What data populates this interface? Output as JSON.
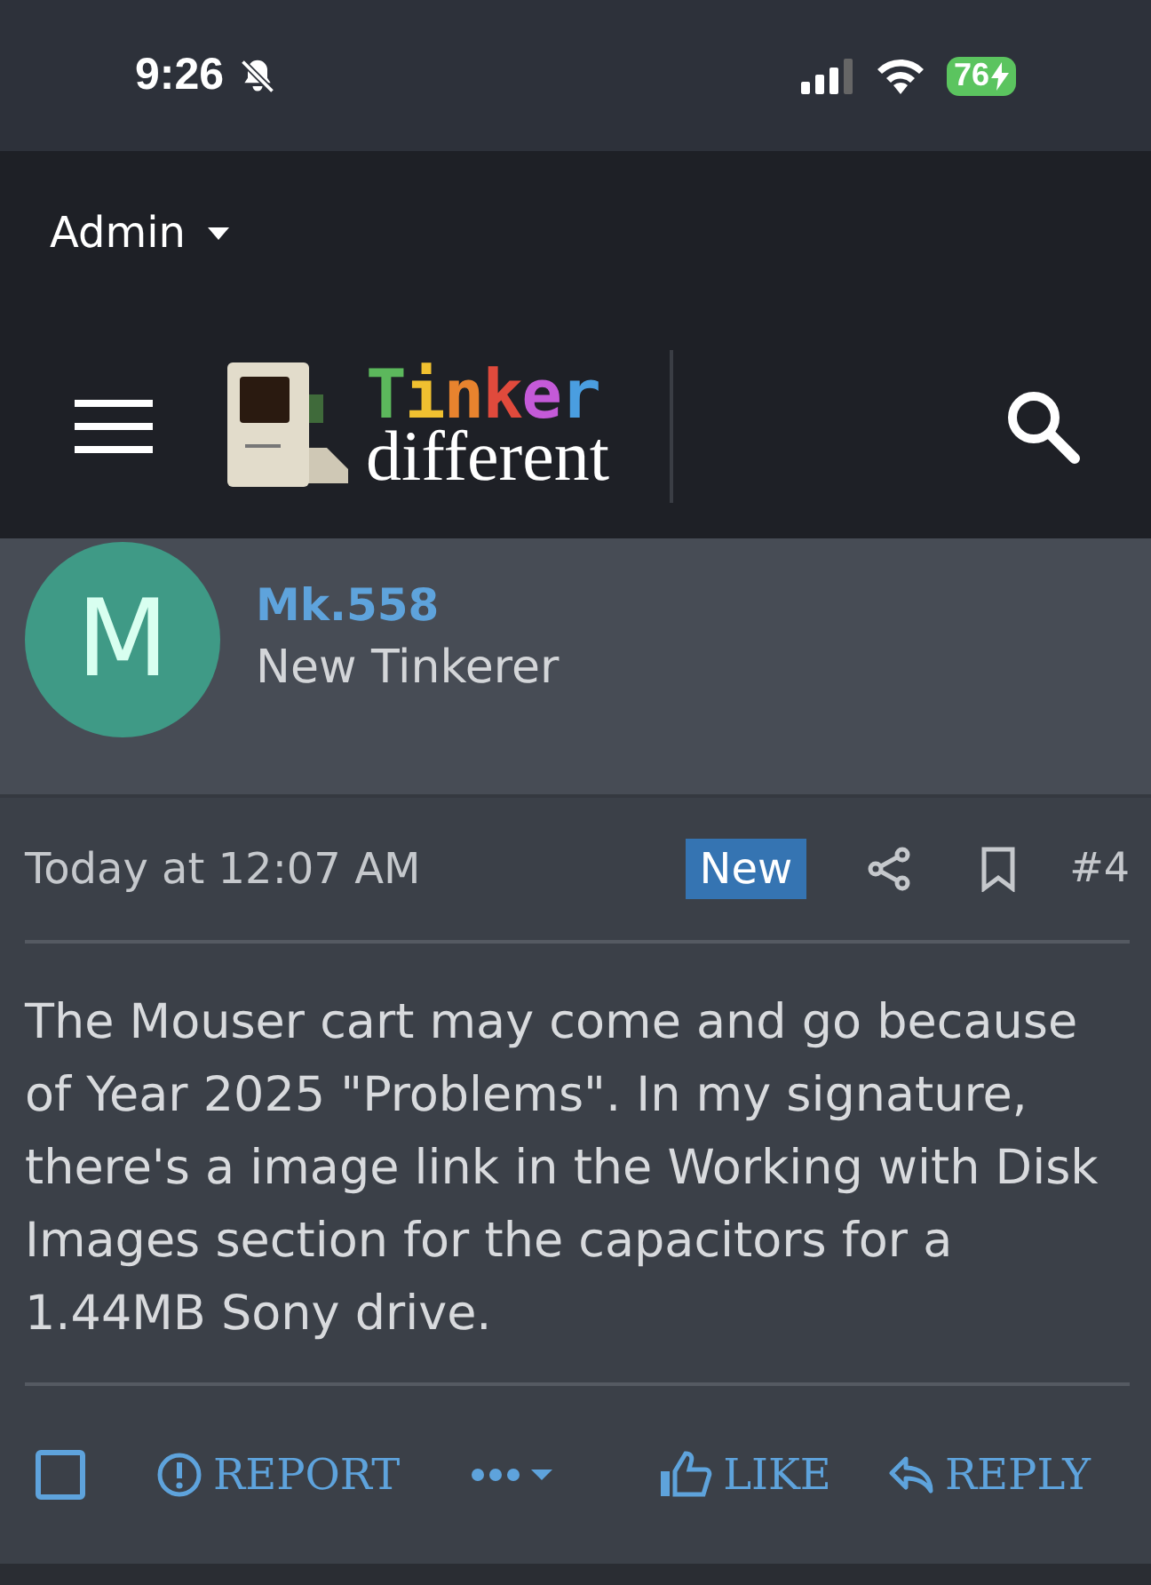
{
  "status_bar": {
    "time": "9:26",
    "battery": "76",
    "charging": true
  },
  "account_menu": {
    "label": "Admin"
  },
  "logo": {
    "letters": [
      {
        "char": "T",
        "color": "#5cb85c"
      },
      {
        "char": "i",
        "color": "#f0c030"
      },
      {
        "char": "n",
        "color": "#e8832e"
      },
      {
        "char": "k",
        "color": "#e04a3c"
      },
      {
        "char": "e",
        "color": "#c45ad8"
      },
      {
        "char": "r",
        "color": "#4a9ee0"
      }
    ],
    "subtitle": "different"
  },
  "author": {
    "initial": "M",
    "name": "Mk.558",
    "title": "New Tinkerer"
  },
  "post": {
    "date": "Today at 12:07 AM",
    "badge": "New",
    "number": "#4",
    "body": "The Mouser cart may come and go because of Year 2025 \"Problems\". In my signature, there's a image link in the Working with Disk Images section for the capacitors for a 1.44MB Sony drive."
  },
  "actions": {
    "select_checked": false,
    "report": "REPORT",
    "like": "LIKE",
    "reply": "REPLY"
  }
}
